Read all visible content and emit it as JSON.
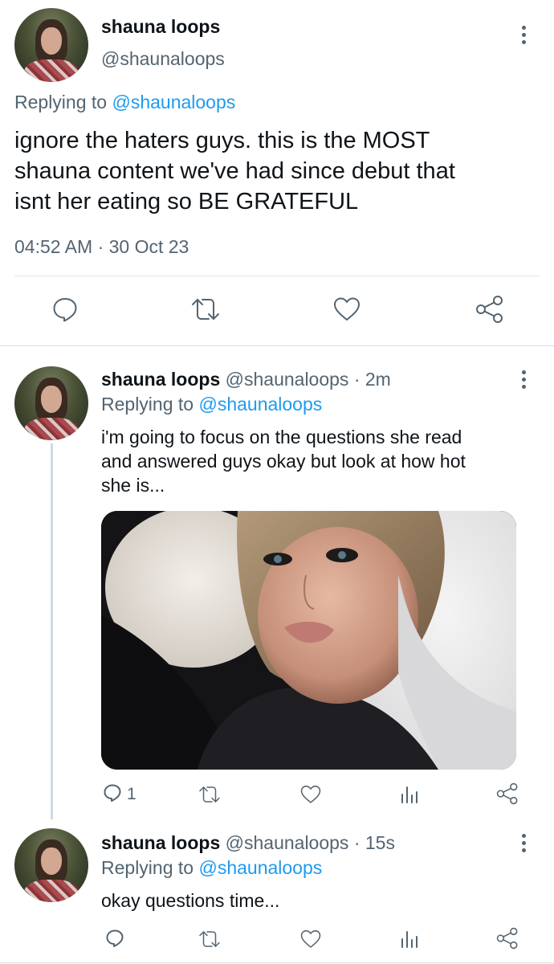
{
  "main_tweet": {
    "author_name": "shauna loops",
    "handle": "@shaunaloops",
    "replying_prefix": "Replying to",
    "replying_handle": "@shaunaloops",
    "text_lines": [
      "ignore the haters guys. this is the MOST",
      "shauna content we've had since debut that",
      "isnt her eating so BE GRATEFUL"
    ],
    "timestamp": "04:52 AM · 30 Oct 23"
  },
  "reply1": {
    "author_name": "shauna loops",
    "handle_time": "@shaunaloops · 2m",
    "replying_prefix": "Replying to",
    "replying_handle": "@shaunaloops",
    "text_lines": [
      "i'm going to focus on the questions she read",
      "and answered guys okay but look at how hot",
      "she is..."
    ],
    "reply_count": "1"
  },
  "reply2": {
    "author_name": "shauna loops",
    "handle_time": "@shaunaloops · 15s",
    "replying_prefix": "Replying to",
    "replying_handle": "@shaunaloops",
    "text_lines": [
      "okay questions time..."
    ]
  },
  "icons": {
    "reply": "speech-bubble-icon",
    "retweet": "retweet-icon",
    "like": "heart-icon",
    "share": "share-icon",
    "views": "bar-chart-icon",
    "more": "kebab-menu-icon"
  },
  "colors": {
    "link": "#1d9bf0",
    "secondary": "#536471",
    "text": "#0f1419",
    "divider": "#e1e6ea"
  }
}
